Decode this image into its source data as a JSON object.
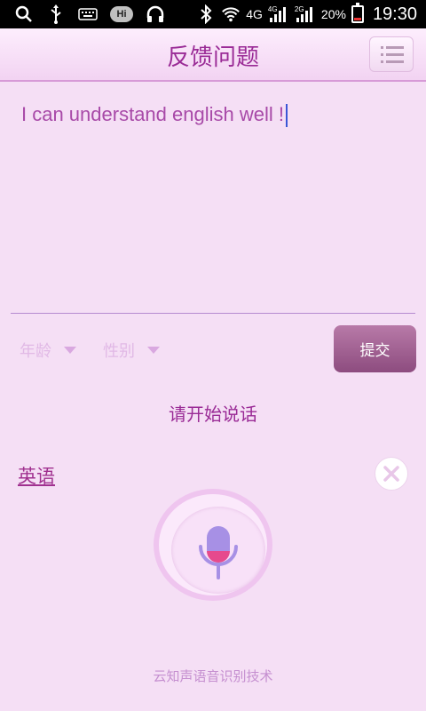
{
  "status_bar": {
    "network": "4G",
    "signal_1_label": "4G",
    "signal_2_label": "2G",
    "battery": "20%",
    "time": "19:30",
    "hi_label": "Hi",
    "icons": [
      "search-icon",
      "usb-icon",
      "keyboard-icon",
      "hi-badge",
      "headphones-icon",
      "bluetooth-icon",
      "wifi-icon",
      "signal-icon",
      "battery-icon"
    ]
  },
  "header": {
    "title": "反馈问题"
  },
  "input": {
    "text": "I can understand english well !"
  },
  "form": {
    "age_label": "年龄",
    "gender_label": "性别",
    "submit_label": "提交"
  },
  "voice": {
    "prompt": "请开始说话",
    "language": "英语"
  },
  "footer": {
    "text": "云知声语音识别技术"
  },
  "colors": {
    "background": "#f5dff5",
    "accent": "#9a2b96",
    "submit": "#8d4c7f"
  }
}
